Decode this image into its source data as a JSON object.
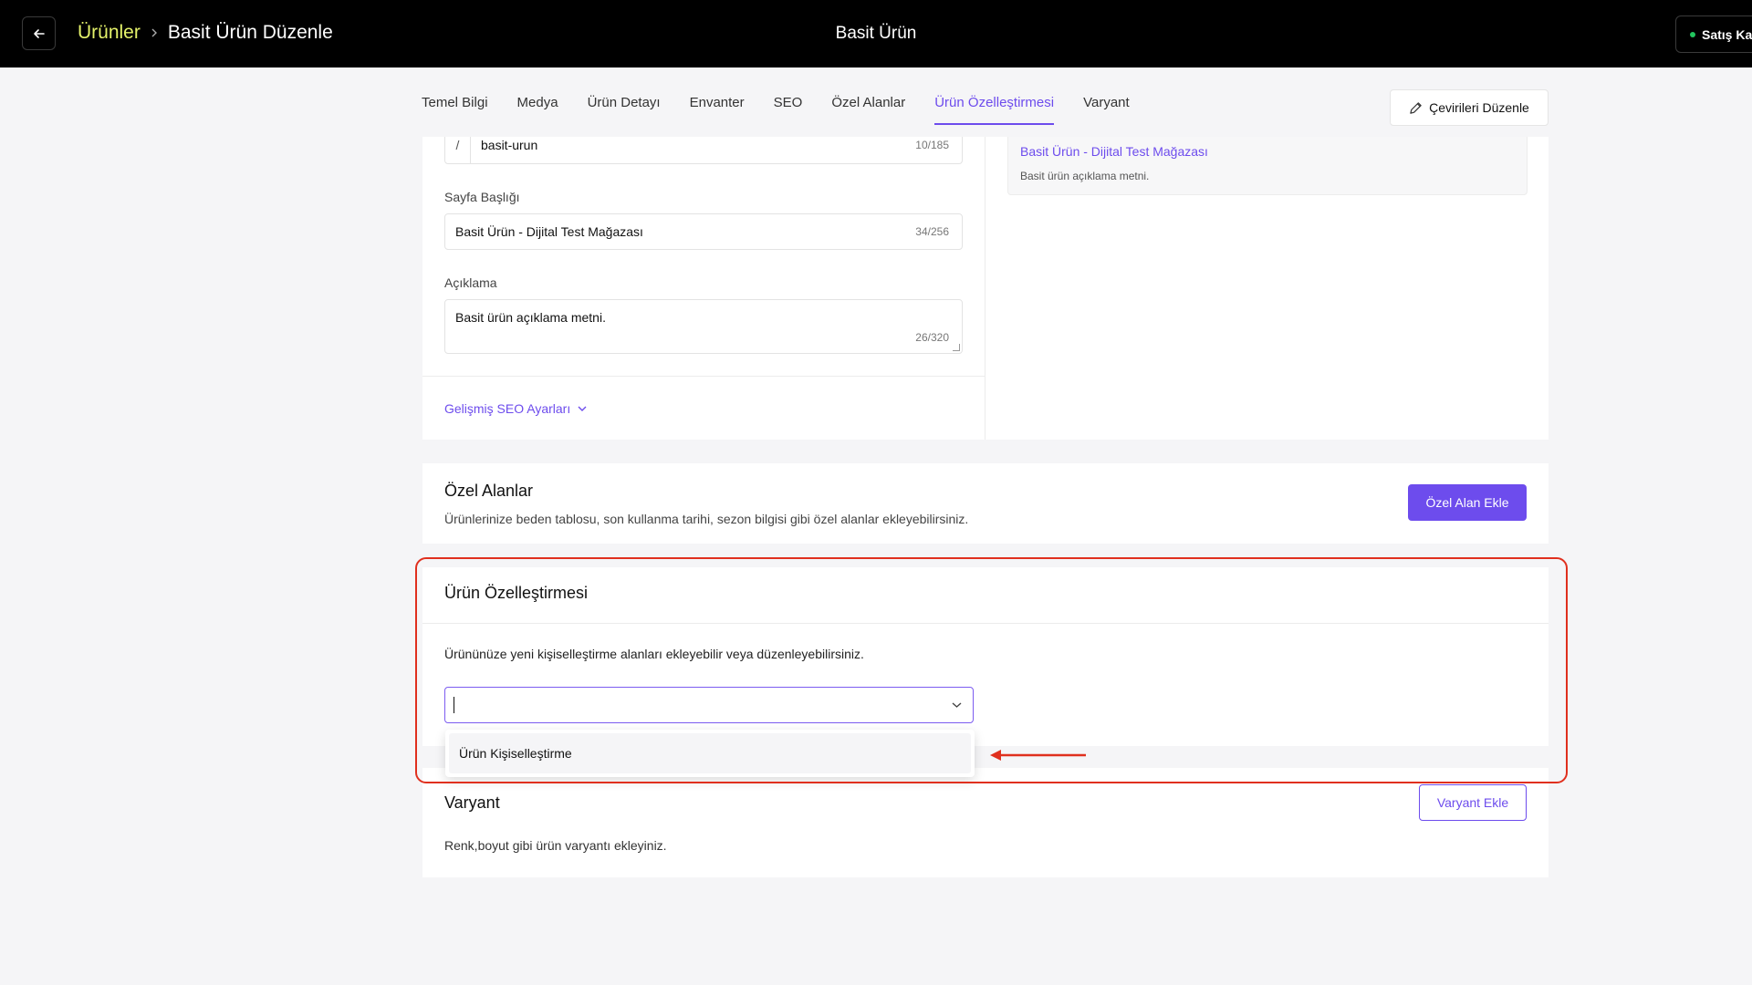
{
  "header": {
    "breadcrumb_parent": "Ürünler",
    "breadcrumb_current": "Basit Ürün Düzenle",
    "center_title": "Basit Ürün",
    "sales_channel_label": "Satış Ka",
    "status_color": "#22c55e",
    "breadcrumb_parent_color": "#e4f26a"
  },
  "tabs": [
    {
      "label": "Temel Bilgi"
    },
    {
      "label": "Medya"
    },
    {
      "label": "Ürün Detayı"
    },
    {
      "label": "Envanter"
    },
    {
      "label": "SEO"
    },
    {
      "label": "Özel Alanlar"
    },
    {
      "label": "Ürün Özelleştirmesi",
      "active": true
    },
    {
      "label": "Varyant"
    }
  ],
  "toolbar": {
    "edit_translations_label": "Çevirileri Düzenle",
    "edit_icon": "pencil-icon"
  },
  "seo": {
    "url_prefix": "/",
    "url_value": "basit-urun",
    "url_count": "10/185",
    "page_title_label": "Sayfa Başlığı",
    "page_title_value": "Basit Ürün - Dijital Test Mağazası",
    "page_title_count": "34/256",
    "description_label": "Açıklama",
    "description_value": "Basit ürün açıklama metni.",
    "description_count": "26/320",
    "advanced_link": "Gelişmiş SEO Ayarları",
    "preview_title": "Basit Ürün - Dijital Test Mağazası",
    "preview_description": "Basit ürün açıklama metni."
  },
  "custom_fields": {
    "title": "Özel Alanlar",
    "subtitle": "Ürünlerinize beden tablosu, son kullanma tarihi, sezon bilgisi gibi özel alanlar ekleyebilirsiniz.",
    "add_button": "Özel Alan Ekle"
  },
  "product_customization": {
    "title": "Ürün Özelleştirmesi",
    "subtitle": "Ürününüze yeni kişiselleştirme alanları ekleyebilir veya düzenleyebilirsiniz.",
    "select_value": "",
    "options": [
      "Ürün Kişiselleştirme"
    ]
  },
  "variant": {
    "title": "Varyant",
    "subtitle": "Renk,boyut gibi ürün varyantı ekleyiniz.",
    "add_button": "Varyant Ekle"
  },
  "colors": {
    "accent": "#6d4ced",
    "annotation": "#e0301e"
  }
}
